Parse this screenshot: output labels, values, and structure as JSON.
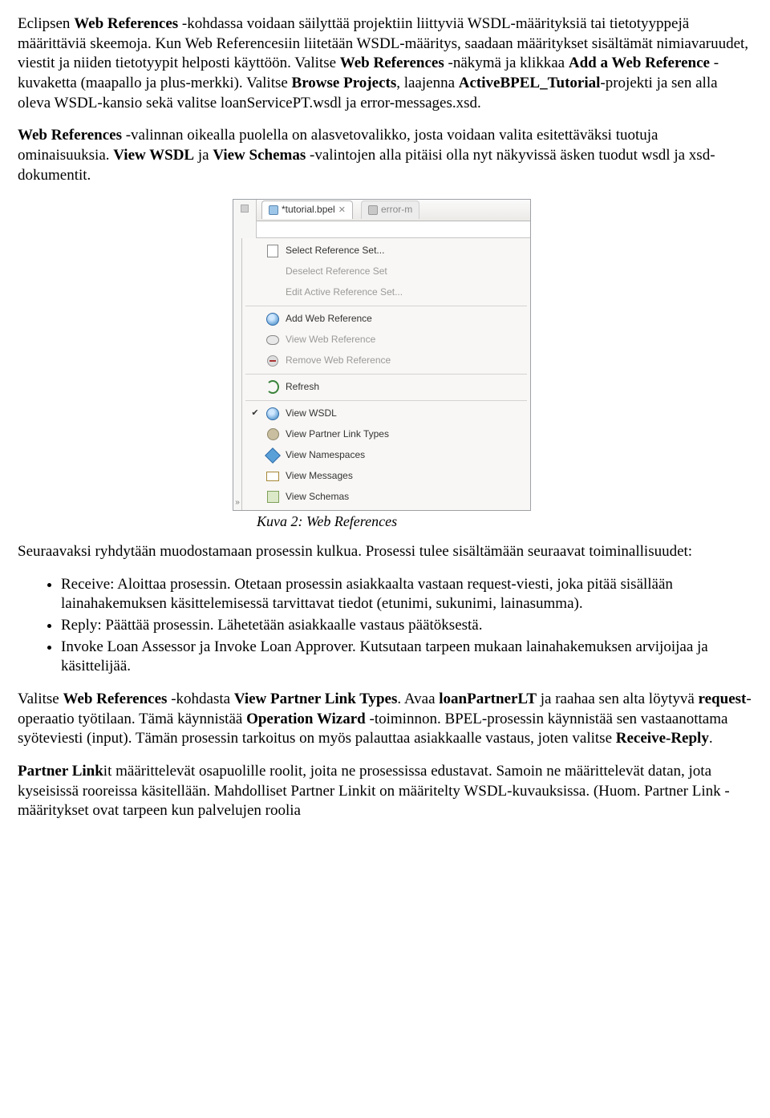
{
  "paragraphs": {
    "p1_a": "Eclipsen ",
    "p1_b": "Web References",
    "p1_c": " -kohdassa voidaan säilyttää projektiin liittyviä WSDL-määrityksiä tai tietotyyppejä määrittäviä skeemoja. Kun Web Referencesiin liitetään WSDL-määritys, saadaan määritykset sisältämät nimiavaruudet, viestit ja niiden tietotyypit helposti käyttöön. Valitse ",
    "p1_d": "Web References",
    "p1_e": " -näkymä ja klikkaa ",
    "p1_f": "Add a Web Reference",
    "p1_g": " -kuvaketta (maapallo ja plus-merkki). Valitse ",
    "p1_h": "Browse Projects",
    "p1_i": ", laajenna ",
    "p1_j": "ActiveBPEL_Tutorial",
    "p1_k": "-projekti ja sen alla oleva WSDL-kansio sekä valitse loanServicePT.wsdl ja error-messages.xsd.",
    "p2_a": "Web References",
    "p2_b": " -valinnan oikealla puolella on alasvetovalikko, josta voidaan valita esitettäväksi tuotuja ominaisuuksia. ",
    "p2_c": "View WSDL",
    "p2_d": " ja ",
    "p2_e": "View Schemas",
    "p2_f": " -valintojen alla pitäisi olla nyt näkyvissä äsken tuodut wsdl ja xsd-dokumentit."
  },
  "figure": {
    "caption": "Kuva 2: Web References",
    "tabs": {
      "t1": "*tutorial.bpel",
      "t2": "error-m"
    },
    "menu": {
      "select_ref": "Select Reference Set...",
      "deselect_ref": "Deselect Reference Set",
      "edit_ref": "Edit Active Reference Set...",
      "add_web": "Add Web Reference",
      "view_web": "View Web Reference",
      "remove_web": "Remove Web Reference",
      "refresh": "Refresh",
      "view_wsdl": "View WSDL",
      "view_plt": "View Partner Link Types",
      "view_ns": "View Namespaces",
      "view_msg": "View Messages",
      "view_schemas": "View Schemas"
    }
  },
  "after": {
    "p3": "Seuraavaksi ryhdytään muodostamaan prosessin kulkua. Prosessi tulee sisältämään seuraavat toiminallisuudet:",
    "bullets": {
      "b1": "Receive: Aloittaa prosessin. Otetaan prosessin asiakkaalta vastaan request-viesti, joka pitää sisällään lainahakemuksen käsittelemisessä tarvittavat tiedot (etunimi, sukunimi, lainasumma).",
      "b2": "Reply: Päättää prosessin. Lähetetään asiakkaalle vastaus päätöksestä.",
      "b3": "Invoke Loan Assessor ja Invoke Loan Approver. Kutsutaan tarpeen mukaan lainahakemuksen arvijoijaa ja käsittelijää."
    },
    "p4_a": "Valitse ",
    "p4_b": "Web References",
    "p4_c": " -kohdasta ",
    "p4_d": "View Partner Link Types",
    "p4_e": ". Avaa ",
    "p4_f": "loanPartnerLT",
    "p4_g": " ja raahaa sen alta löytyvä ",
    "p4_h": "request",
    "p4_i": "-operaatio työtilaan. Tämä käynnistää ",
    "p4_j": "Operation Wizard",
    "p4_k": " -toiminnon. BPEL-prosessin käynnistää sen vastaanottama syöteviesti (input). Tämän prosessin tarkoitus on myös palauttaa asiakkaalle vastaus, joten valitse ",
    "p4_l": "Receive-Reply",
    "p4_m": ".",
    "p5_a": "Partner Link",
    "p5_b": "it määrittelevät osapuolille roolit, joita ne prosessissa edustavat. Samoin ne määrittelevät datan, jota kyseisissä rooreissa käsitellään. Mahdolliset Partner Linkit on määritelty WSDL-kuvauksissa. (Huom. Partner Link -määritykset ovat tarpeen kun palvelujen roolia"
  }
}
